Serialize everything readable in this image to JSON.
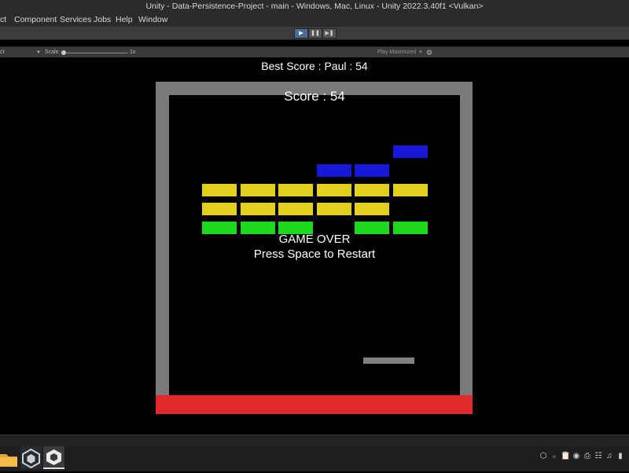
{
  "window": {
    "title": "Unity - Data-Persistence-Project - main - Windows, Mac, Linux - Unity 2022.3.40f1 <Vulkan>"
  },
  "menu": {
    "items": [
      "ct",
      "Component",
      "Services",
      "Jobs",
      "Help",
      "Window"
    ]
  },
  "toolbar": {
    "play_icon": "play-icon",
    "pause_icon": "pause-icon",
    "step_icon": "step-icon"
  },
  "game_toolbar": {
    "display_fragment": "ct",
    "scale_label": "Scale",
    "scale_value": "1x",
    "play_mode_label": "Play Maximized",
    "gizmo_icon": "gear-icon"
  },
  "game": {
    "best_score": "Best Score : Paul : 54",
    "score": "Score : 54",
    "game_over": "GAME OVER",
    "restart_hint": "Press Space to Restart",
    "colors": {
      "wall": "#7a7a7a",
      "floor": "#e02a2a",
      "paddle": "#808080",
      "blue": "#1818d8",
      "yellow": "#e3cf1d",
      "green": "#1ed81e"
    },
    "brick_rows": [
      {
        "color": "blue",
        "present": [
          false,
          false,
          false,
          false,
          false,
          true
        ]
      },
      {
        "color": "blue",
        "present": [
          false,
          false,
          false,
          true,
          true,
          false
        ]
      },
      {
        "color": "yellow",
        "present": [
          true,
          true,
          true,
          true,
          true,
          true
        ]
      },
      {
        "color": "yellow",
        "present": [
          true,
          true,
          true,
          true,
          true,
          false
        ]
      },
      {
        "color": "green",
        "present": [
          true,
          true,
          true,
          false,
          true,
          true
        ]
      }
    ]
  },
  "taskbar": {
    "apps": [
      "folder-icon",
      "unity-hub-icon",
      "unity-editor-icon"
    ]
  },
  "tray": {
    "icons": [
      "unity-tray-icon",
      "bluetooth-icon",
      "clipboard-icon",
      "steam-icon",
      "printer-icon",
      "network-icon",
      "music-icon",
      "battery-icon"
    ]
  }
}
